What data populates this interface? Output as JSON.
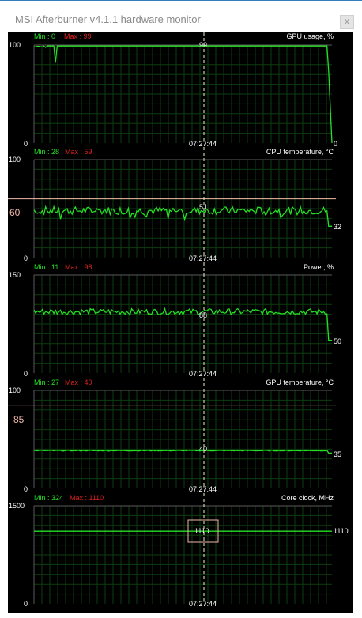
{
  "window": {
    "title": "MSI Afterburner v4.1.1 hardware monitor",
    "close_label": "x"
  },
  "cursor_time": "07:27:44",
  "colors": {
    "line": "#24e024",
    "grid": "#0e3d10",
    "cursor": "#f2f2c8",
    "limit": "#f0b8a8",
    "min": "#24e024",
    "max": "#e02020"
  },
  "graphs": [
    {
      "name": "GPU usage, %",
      "min_text": "Min : 0",
      "max_text": "Max : 99",
      "scale_max": "100",
      "scale_min": "0",
      "cursor_value": "99",
      "current_value": "0",
      "limit": null
    },
    {
      "name": "CPU temperature, °C",
      "min_text": "Min : 28",
      "max_text": "Max : 59",
      "scale_max": "100",
      "scale_min": "0",
      "cursor_value": "51",
      "current_value": "32",
      "limit": "60"
    },
    {
      "name": "Power, %",
      "min_text": "Min : 11",
      "max_text": "Max : 98",
      "scale_max": "150",
      "scale_min": "0",
      "cursor_value": "88",
      "current_value": "50",
      "limit": null
    },
    {
      "name": "GPU temperature, °C",
      "min_text": "Min : 27",
      "max_text": "Max : 40",
      "scale_max": "100",
      "scale_min": "0",
      "cursor_value": "40",
      "current_value": "35",
      "limit": "85"
    },
    {
      "name": "Core clock, MHz",
      "min_text": "Min : 324",
      "max_text": "Max : 1110",
      "scale_max": "1500",
      "scale_min": "0",
      "cursor_value": "1110",
      "current_value": "1110",
      "limit": null
    }
  ]
}
